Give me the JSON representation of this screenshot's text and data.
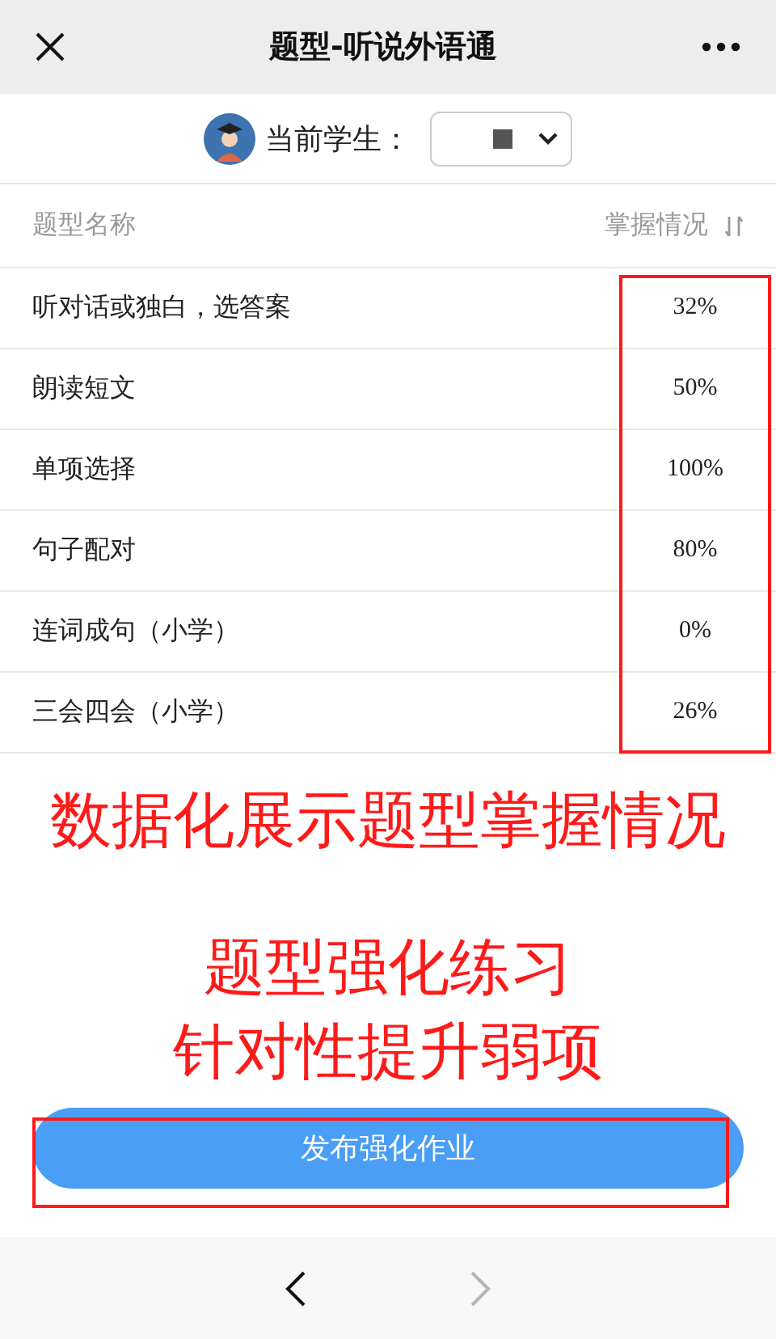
{
  "nav_bar": {
    "title": "题型-听说外语通"
  },
  "student_picker": {
    "label": "当前学生："
  },
  "table": {
    "columns": [
      "题型名称",
      "掌握情况"
    ],
    "rows": [
      {
        "name": "听对话或独白，选答案",
        "mastery": "32%"
      },
      {
        "name": "朗读短文",
        "mastery": "50%"
      },
      {
        "name": "单项选择",
        "mastery": "100%"
      },
      {
        "name": "句子配对",
        "mastery": "80%"
      },
      {
        "name": "连词成句（小学）",
        "mastery": "0%"
      },
      {
        "name": "三会四会（小学）",
        "mastery": "26%"
      }
    ]
  },
  "annotations": {
    "headline": "数据化展示题型掌握情况",
    "caption_lines": [
      "题型强化练习",
      "针对性提升弱项"
    ]
  },
  "publish_button": {
    "label": "发布强化作业"
  },
  "bottom_nav": {
    "back_disabled": false,
    "forward_disabled": true
  }
}
